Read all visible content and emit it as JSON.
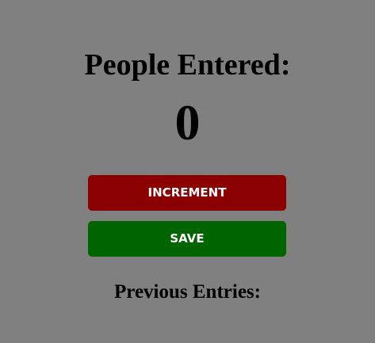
{
  "heading": "People Entered:",
  "count": "0",
  "buttons": {
    "increment_label": "INCREMENT",
    "save_label": "SAVE"
  },
  "previous_entries": {
    "label": "Previous Entries:",
    "items": []
  },
  "colors": {
    "background": "#808080",
    "increment_button": "#8b0000",
    "save_button": "#006400",
    "button_text": "#ffffff"
  }
}
